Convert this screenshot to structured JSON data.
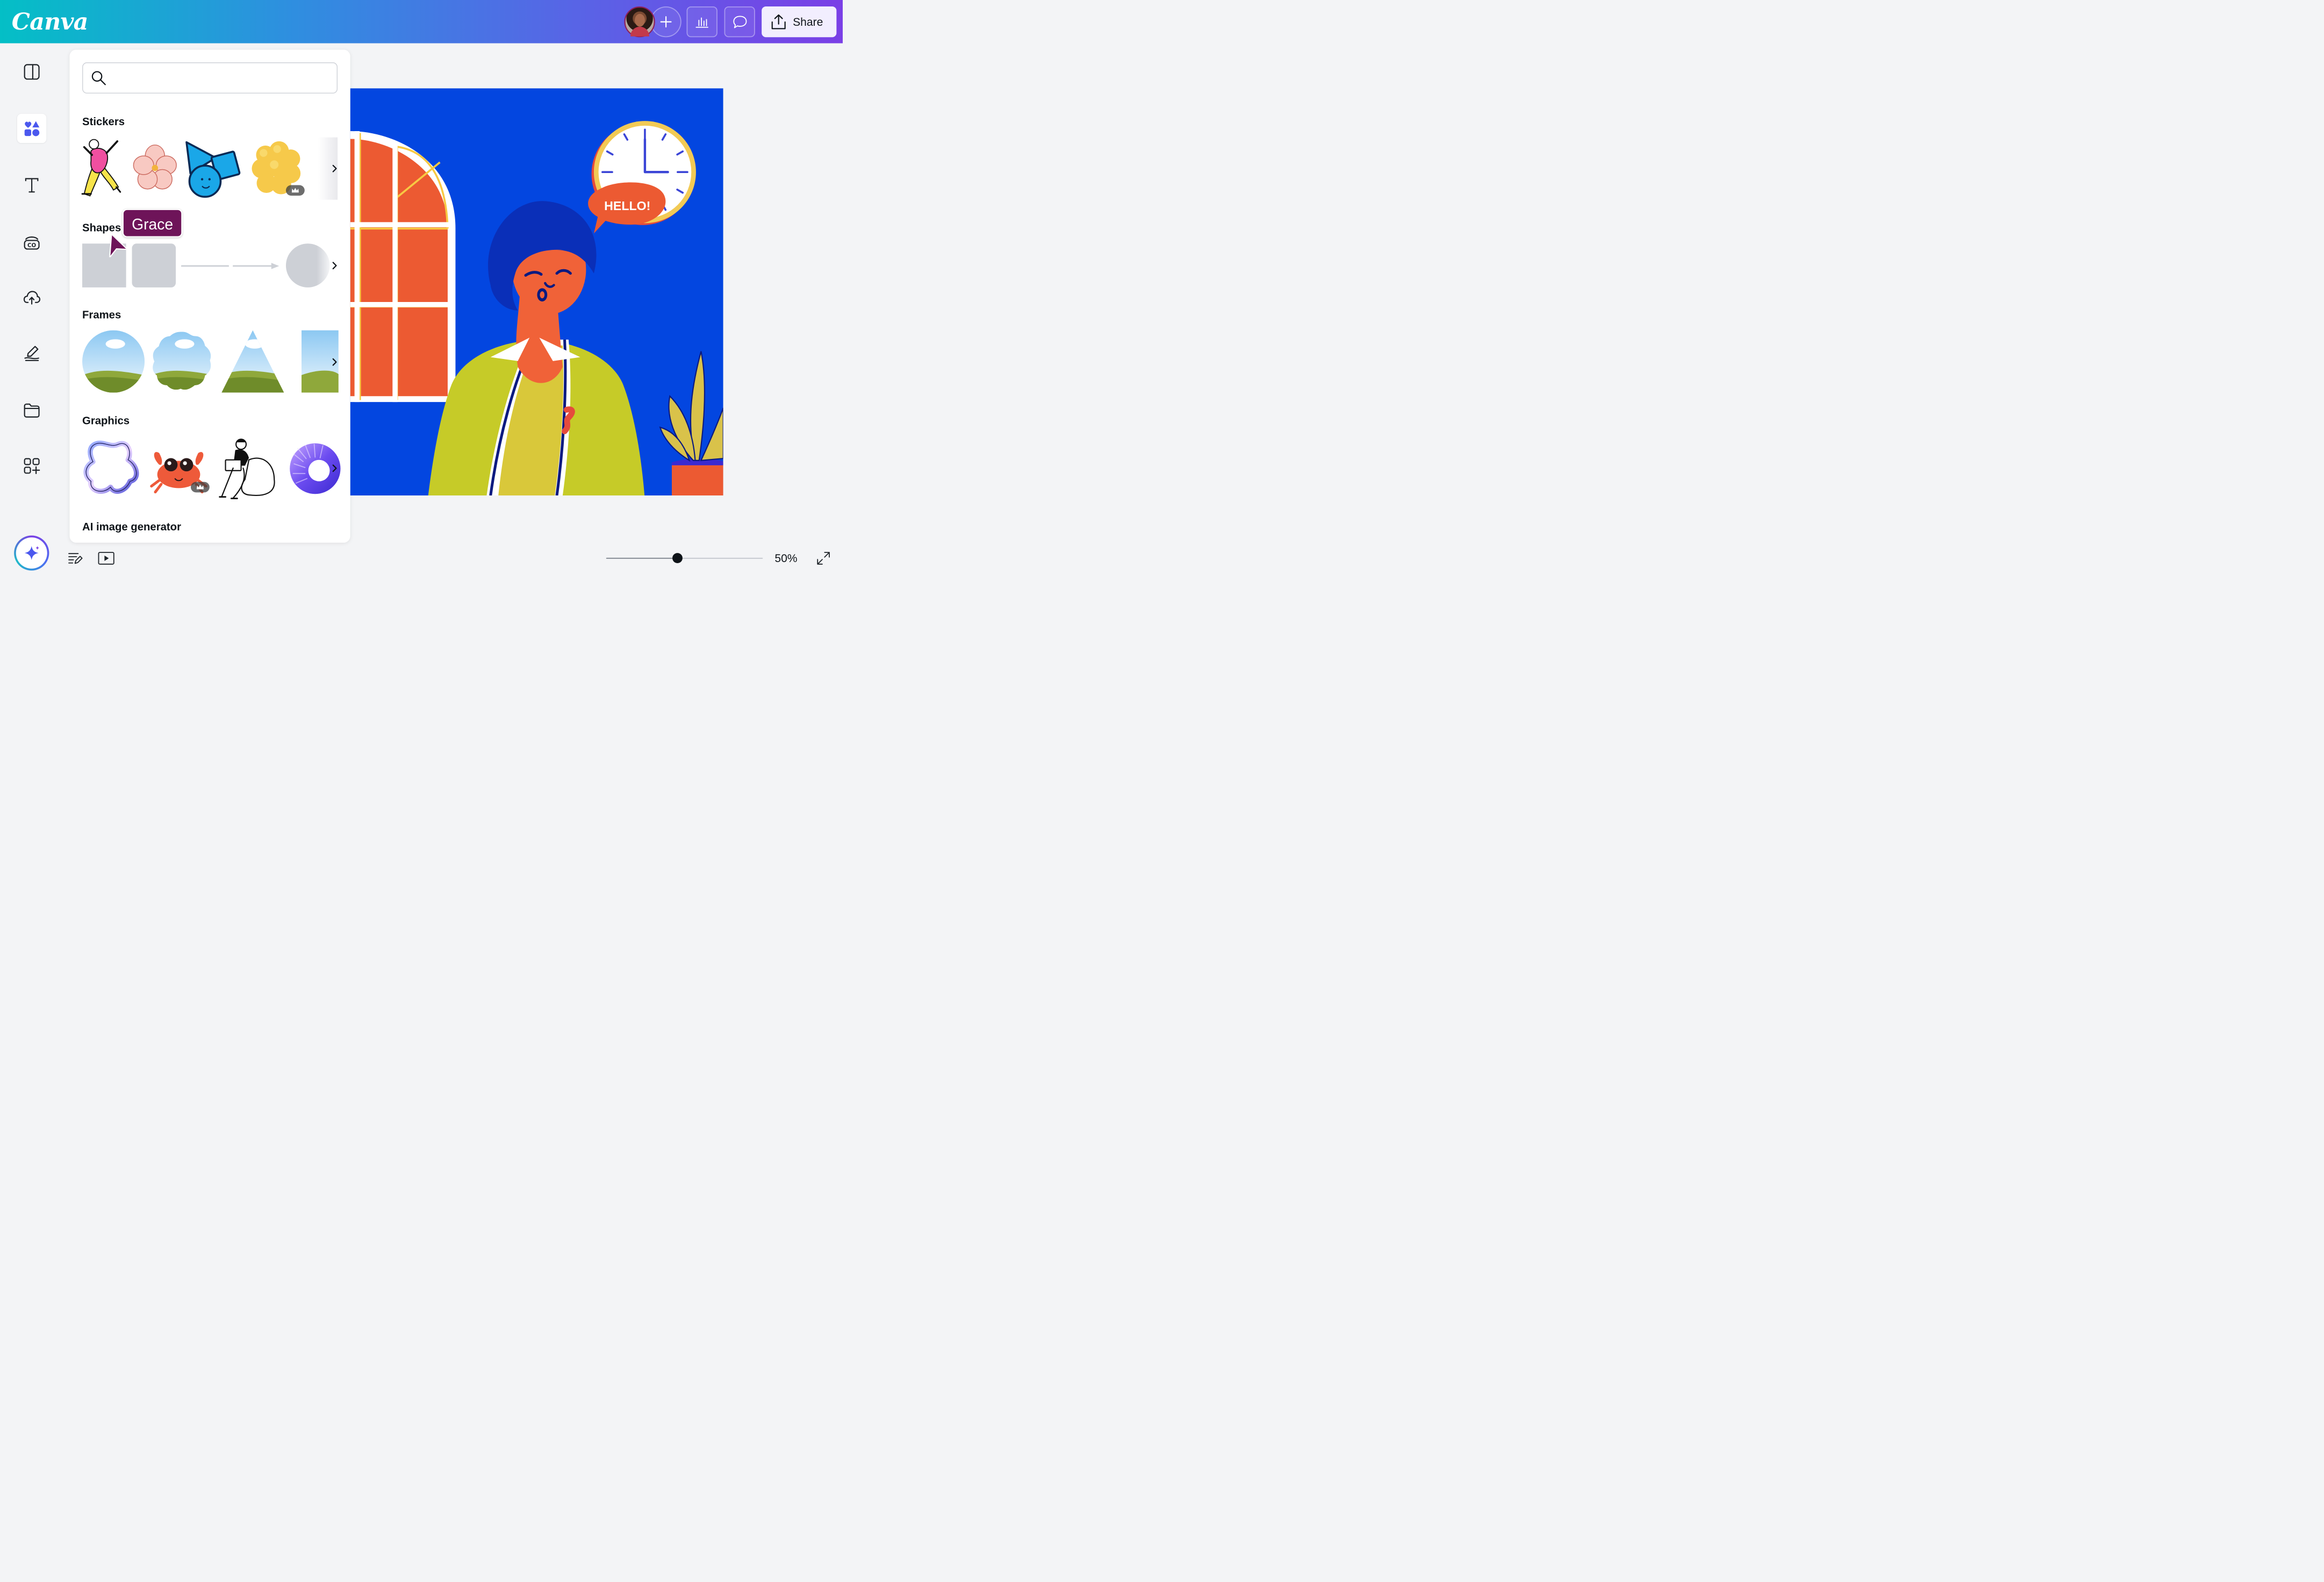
{
  "app": {
    "logo_text": "Canva"
  },
  "header": {
    "share_label": "Share"
  },
  "panel": {
    "search": {
      "placeholder": "",
      "value": ""
    },
    "sections": [
      {
        "title": "Stickers"
      },
      {
        "title": "Shapes"
      },
      {
        "title": "Frames"
      },
      {
        "title": "Graphics"
      },
      {
        "title": "AI image generator"
      }
    ]
  },
  "collaborator": {
    "name": "Grace"
  },
  "canvas": {
    "speech_bubble_text": "HELLO!"
  },
  "footer": {
    "zoom_label": "50%",
    "zoom_percent": 50
  },
  "colors": {
    "accent": "#7d2ae8",
    "collaborator": "#6e1459",
    "canvas_background": "#0346e0"
  }
}
